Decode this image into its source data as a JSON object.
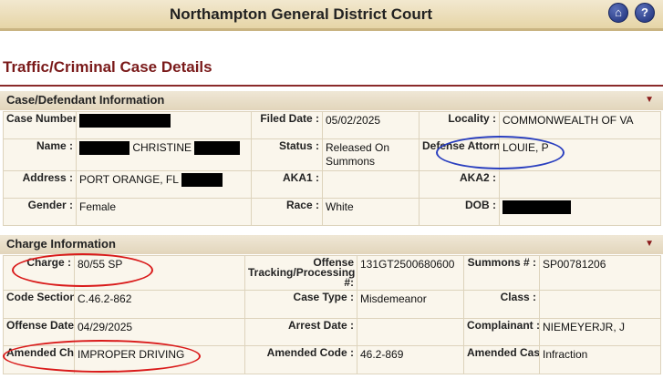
{
  "header": {
    "title": "Northampton General District Court",
    "home_icon": "home-icon",
    "help_icon": "help-icon"
  },
  "page_title": "Traffic/Criminal Case Details",
  "case_section": {
    "heading": "Case/Defendant Information",
    "case_number_label": "Case Number :",
    "filed_date_label": "Filed Date :",
    "filed_date": "05/02/2025",
    "locality_label": "Locality :",
    "locality": "COMMONWEALTH OF VA",
    "name_label": "Name :",
    "name_visible": "CHRISTINE",
    "status_label": "Status :",
    "status": "Released On Summons",
    "defense_attorney_label": "Defense Attorney :",
    "defense_attorney": "LOUIE, P",
    "address_label": "Address :",
    "address": "PORT ORANGE, FL",
    "aka1_label": "AKA1 :",
    "aka2_label": "AKA2 :",
    "gender_label": "Gender :",
    "gender": "Female",
    "race_label": "Race :",
    "race": "White",
    "dob_label": "DOB :"
  },
  "charge_section": {
    "heading": "Charge Information",
    "charge_label": "Charge :",
    "charge": "80/55 SP",
    "offense_tracking_label": "Offense Tracking/Processing #:",
    "offense_tracking": "131GT2500680600",
    "summons_label": "Summons # :",
    "summons": "SP00781206",
    "code_section_label": "Code Section :",
    "code_section": "C.46.2-862",
    "case_type_label": "Case Type :",
    "case_type": "Misdemeanor",
    "class_label": "Class :",
    "offense_date_label": "Offense Date :",
    "offense_date": "04/29/2025",
    "arrest_date_label": "Arrest Date :",
    "complainant_label": "Complainant :",
    "complainant": "NIEMEYERJR, J",
    "amended_charge_label": "Amended Charge :",
    "amended_charge": "IMPROPER DRIVING",
    "amended_code_label": "Amended Code :",
    "amended_code": "46.2-869",
    "amended_case_type_label": "Amended Case Type :",
    "amended_case_type": "Infraction"
  },
  "colors": {
    "annotation_red": "#d91a1a",
    "annotation_blue": "#2a3fbf",
    "title_maroon": "#7a1a1a"
  }
}
